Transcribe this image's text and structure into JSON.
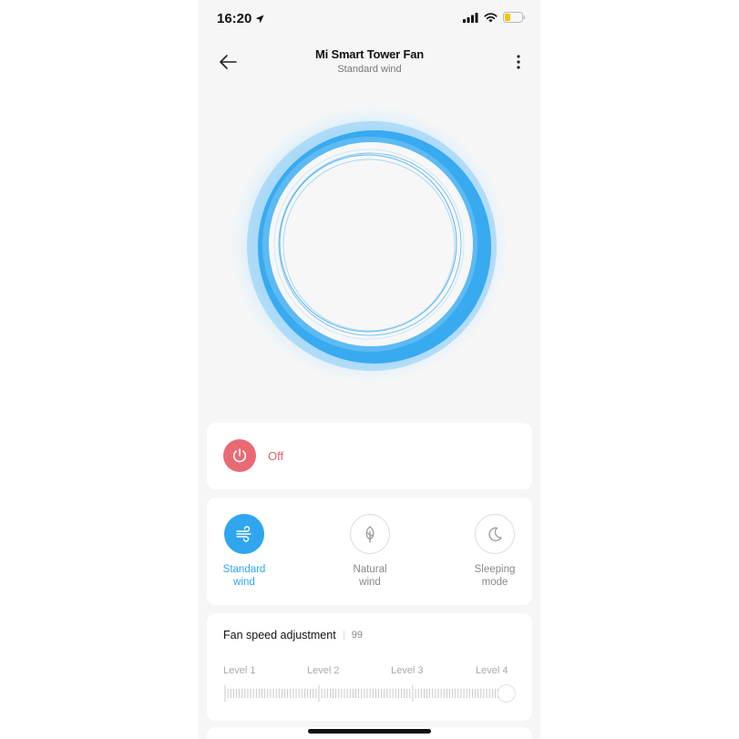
{
  "status_bar": {
    "time": "16:20"
  },
  "header": {
    "title": "Mi Smart Tower Fan",
    "subtitle": "Standard wind"
  },
  "power": {
    "label": "Off"
  },
  "modes": [
    {
      "label_line1": "Standard",
      "label_line2": "wind",
      "active": true
    },
    {
      "label_line1": "Natural",
      "label_line2": "wind",
      "active": false
    },
    {
      "label_line1": "Sleeping",
      "label_line2": "mode",
      "active": false
    }
  ],
  "speed": {
    "title": "Fan speed adjustment",
    "value": "99",
    "levels": [
      "Level 1",
      "Level 2",
      "Level 3",
      "Level 4"
    ],
    "fraction": 0.99
  },
  "colors": {
    "accent": "#2fa6ef",
    "power_off": "#ea6a74",
    "background": "#f6f6f6"
  },
  "icons": {
    "location": "location-arrow-icon",
    "signal": "signal-icon",
    "wifi": "wifi-icon",
    "battery": "battery-icon",
    "back": "arrow-left-icon",
    "more": "more-vertical-icon",
    "power": "power-icon",
    "standard": "wind-icon",
    "natural": "leaf-icon",
    "sleeping": "moon-icon"
  }
}
